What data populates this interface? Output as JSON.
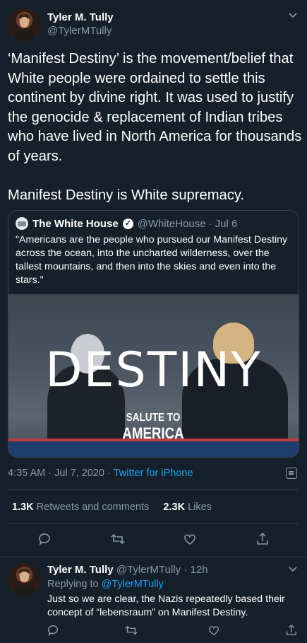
{
  "tweet": {
    "author_name": "Tyler M. Tully",
    "author_handle": "@TylerMTully",
    "text": "‘Manifest Destiny’ is the movement/belief that White people were ordained to settle this continent by divine right. It was used to justify the genocide & replacement of Indian tribes who have lived in North America for thousands of years.\n\nManifest Destiny is White supremacy.",
    "time": "4:35 AM",
    "date": "Jul 7, 2020",
    "source": "Twitter for iPhone",
    "retweets_count": "1.3K",
    "retweets_label": "Retweets and comments",
    "likes_count": "2.3K",
    "likes_label": "Likes"
  },
  "quote": {
    "author_name": "The White House",
    "author_handle": "@WhiteHouse",
    "separator": "·",
    "date": "Jul 6",
    "text": "\"Americans are the people who pursued our Manifest Destiny across the ocean, into the uncharted wilderness, over the tallest mountains, and then into the skies and even into the stars.\"",
    "media": {
      "headline": "DESTINY",
      "logo_line1": "SALUTE TO",
      "logo_line2": "AMERICA"
    }
  },
  "reply": {
    "author_name": "Tyler M. Tully",
    "author_handle": "@TylerMTully",
    "separator": "·",
    "time_ago": "12h",
    "replying_to_label": "Replying to",
    "replying_to_handle": "@TylerMTully",
    "text": "Just so we are clear, the Nazis repeatedly based their concept of “lebensraum” on Manifest Destiny."
  },
  "meta_separator": "·",
  "colors": {
    "background": "#15202b",
    "accent": "#1da1f2",
    "muted": "#8899a6",
    "divider": "#38444d"
  },
  "icons": [
    "chevron-down-icon",
    "verified-badge-icon",
    "reply-icon",
    "retweet-icon",
    "like-icon",
    "share-icon",
    "analytics-icon"
  ]
}
